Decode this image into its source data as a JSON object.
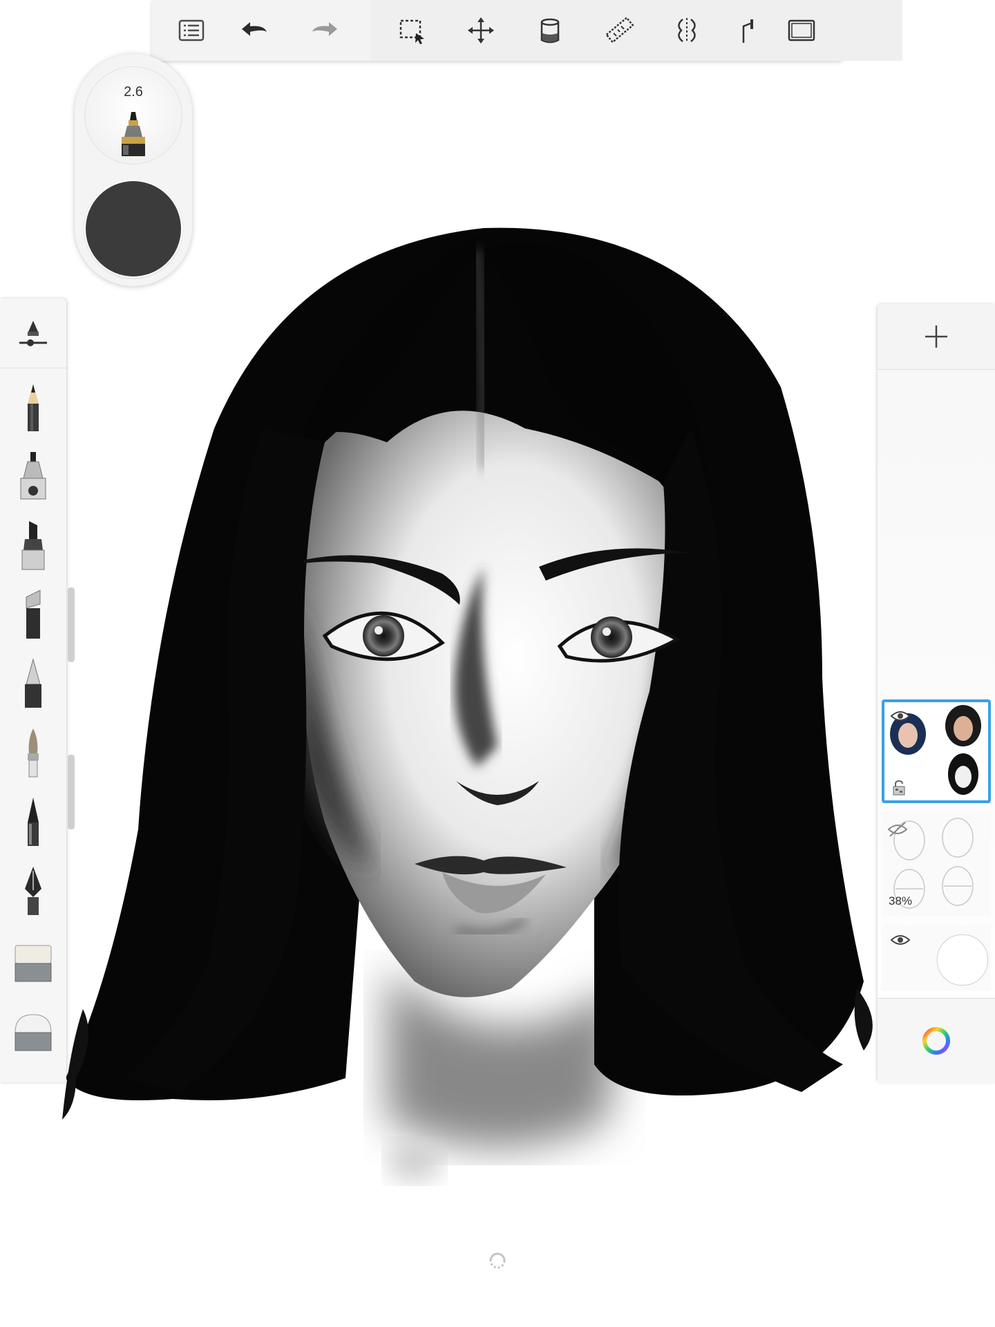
{
  "toolbar": {
    "tools": [
      {
        "name": "layers-list",
        "icon": "list-icon"
      },
      {
        "name": "undo",
        "icon": "undo-icon"
      },
      {
        "name": "redo",
        "icon": "redo-icon"
      },
      {
        "name": "selection",
        "icon": "selection-icon"
      },
      {
        "name": "transform",
        "icon": "move-icon"
      },
      {
        "name": "fill",
        "icon": "paint-bucket-icon"
      },
      {
        "name": "ruler",
        "icon": "ruler-icon"
      },
      {
        "name": "symmetry",
        "icon": "symmetry-icon"
      },
      {
        "name": "perspective",
        "icon": "perspective-icon"
      },
      {
        "name": "fullscreen",
        "icon": "fullscreen-icon"
      }
    ]
  },
  "puck": {
    "size_value": "2.6",
    "color": "#3b3b3b"
  },
  "brush_palette": {
    "brushes": [
      "pencil",
      "airbrush",
      "marker",
      "chisel-marker",
      "ballpoint-pen",
      "paint-brush",
      "fine-pen",
      "fountain-pen",
      "soft-eraser",
      "hard-eraser"
    ]
  },
  "layers": {
    "items": [
      {
        "name": "color-layer",
        "active": true,
        "visible": true,
        "locked": false
      },
      {
        "name": "sketch-layer",
        "active": false,
        "visible": false,
        "opacity": "38%"
      },
      {
        "name": "background-layer",
        "active": false,
        "visible": true
      }
    ]
  },
  "colors": {
    "accent": "#39a0e8",
    "toolbar_bg": "#f3f3f3"
  }
}
